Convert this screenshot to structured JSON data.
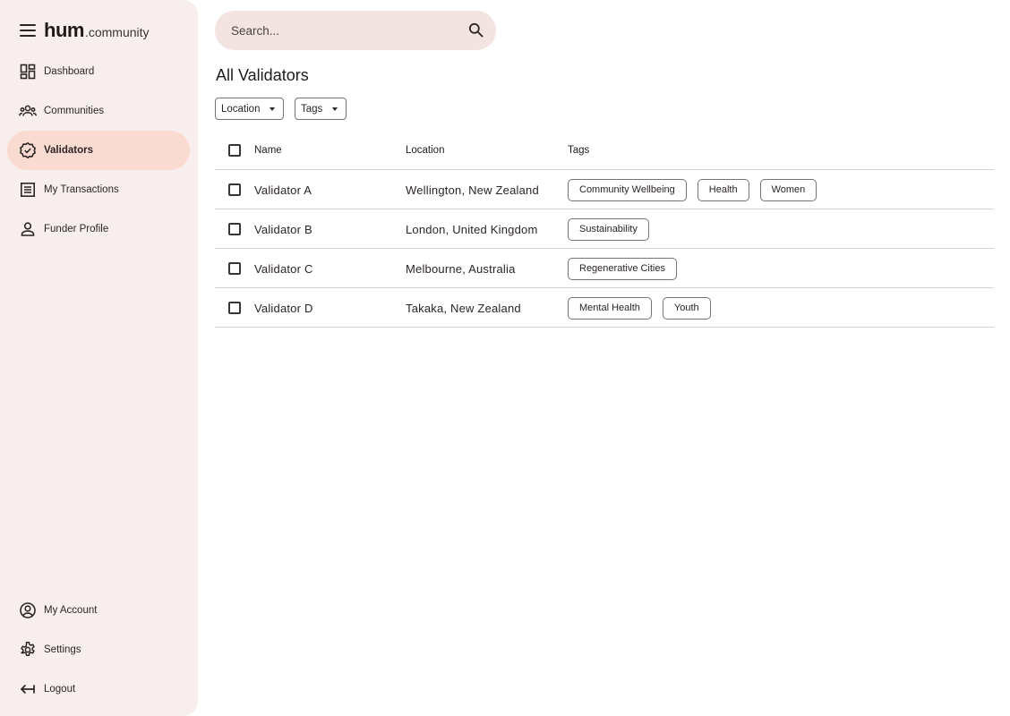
{
  "brand": {
    "name": "hum",
    "suffix": ".community"
  },
  "nav": {
    "main": [
      {
        "label": "Dashboard",
        "icon": "dashboard-icon"
      },
      {
        "label": "Communities",
        "icon": "groups-icon"
      },
      {
        "label": "Validators",
        "icon": "verified-badge-icon",
        "active": true
      },
      {
        "label": "My Transactions",
        "icon": "receipt-list-icon"
      },
      {
        "label": "Funder Profile",
        "icon": "person-icon"
      }
    ],
    "bottom": [
      {
        "label": "My Account",
        "icon": "account-circle-icon"
      },
      {
        "label": "Settings",
        "icon": "gear-icon"
      },
      {
        "label": "Logout",
        "icon": "logout-arrow-icon"
      }
    ]
  },
  "search": {
    "placeholder": "Search...",
    "value": ""
  },
  "page": {
    "title": "All Validators"
  },
  "filters": {
    "location_label": "Location",
    "tags_label": "Tags"
  },
  "table": {
    "columns": {
      "name": "Name",
      "location": "Location",
      "tags": "Tags"
    },
    "rows": [
      {
        "name": "Validator A",
        "location": "Wellington, New Zealand",
        "tags": [
          "Community Wellbeing",
          "Health",
          "Women"
        ]
      },
      {
        "name": "Validator B",
        "location": "London, United Kingdom",
        "tags": [
          "Sustainability"
        ]
      },
      {
        "name": "Validator C",
        "location": "Melbourne, Australia",
        "tags": [
          "Regenerative Cities"
        ]
      },
      {
        "name": "Validator D",
        "location": "Takaka, New Zealand",
        "tags": [
          "Mental Health",
          "Youth"
        ]
      }
    ]
  },
  "colors": {
    "sidebar_bg": "#f9eeee",
    "active_nav_bg": "#fadbd2",
    "search_bg": "#f3e3e1",
    "text": "#1f1b1a",
    "border": "#7a7271"
  }
}
